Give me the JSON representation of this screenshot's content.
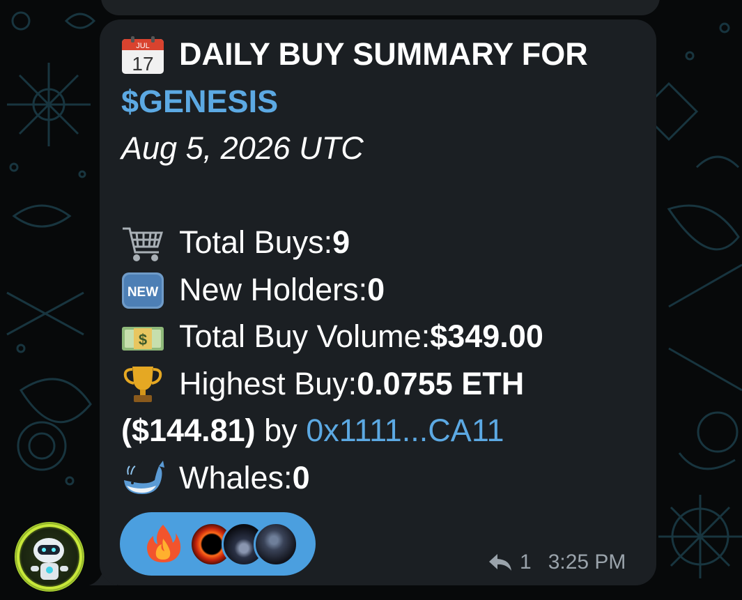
{
  "message": {
    "title_line1": "DAILY BUY SUMMARY FOR",
    "ticker": "$GENESIS",
    "date": "Aug 5, 2026 UTC",
    "stats": {
      "total_buys_label": "Total Buys: ",
      "total_buys_value": "9",
      "new_holders_label": "New Holders: ",
      "new_holders_value": "0",
      "buy_volume_label": "Total Buy Volume: ",
      "buy_volume_value": "$349.00",
      "highest_buy_label": "Highest Buy: ",
      "highest_buy_value": "0.0755 ETH",
      "highest_buy_usd": "($144.81)",
      "by_text": " by ",
      "buyer_address": "0x1111...CA11",
      "whales_label": "Whales: ",
      "whales_value": "0"
    },
    "icons": {
      "calendar_month": "JUL",
      "calendar_day": "17",
      "new_badge": "NEW",
      "money_symbol": "$"
    }
  },
  "reactions": {
    "first": "🔥",
    "avatars": [
      "reactor-avatar-1",
      "reactor-avatar-2",
      "reactor-avatar-3"
    ]
  },
  "meta": {
    "reply_count": "1",
    "time": "3:25 PM"
  },
  "colors": {
    "bubble": "#1b1f23",
    "accent": "#5ca9e3",
    "reaction_bg": "#4b9fdf",
    "meta_text": "#9aa3ab"
  }
}
